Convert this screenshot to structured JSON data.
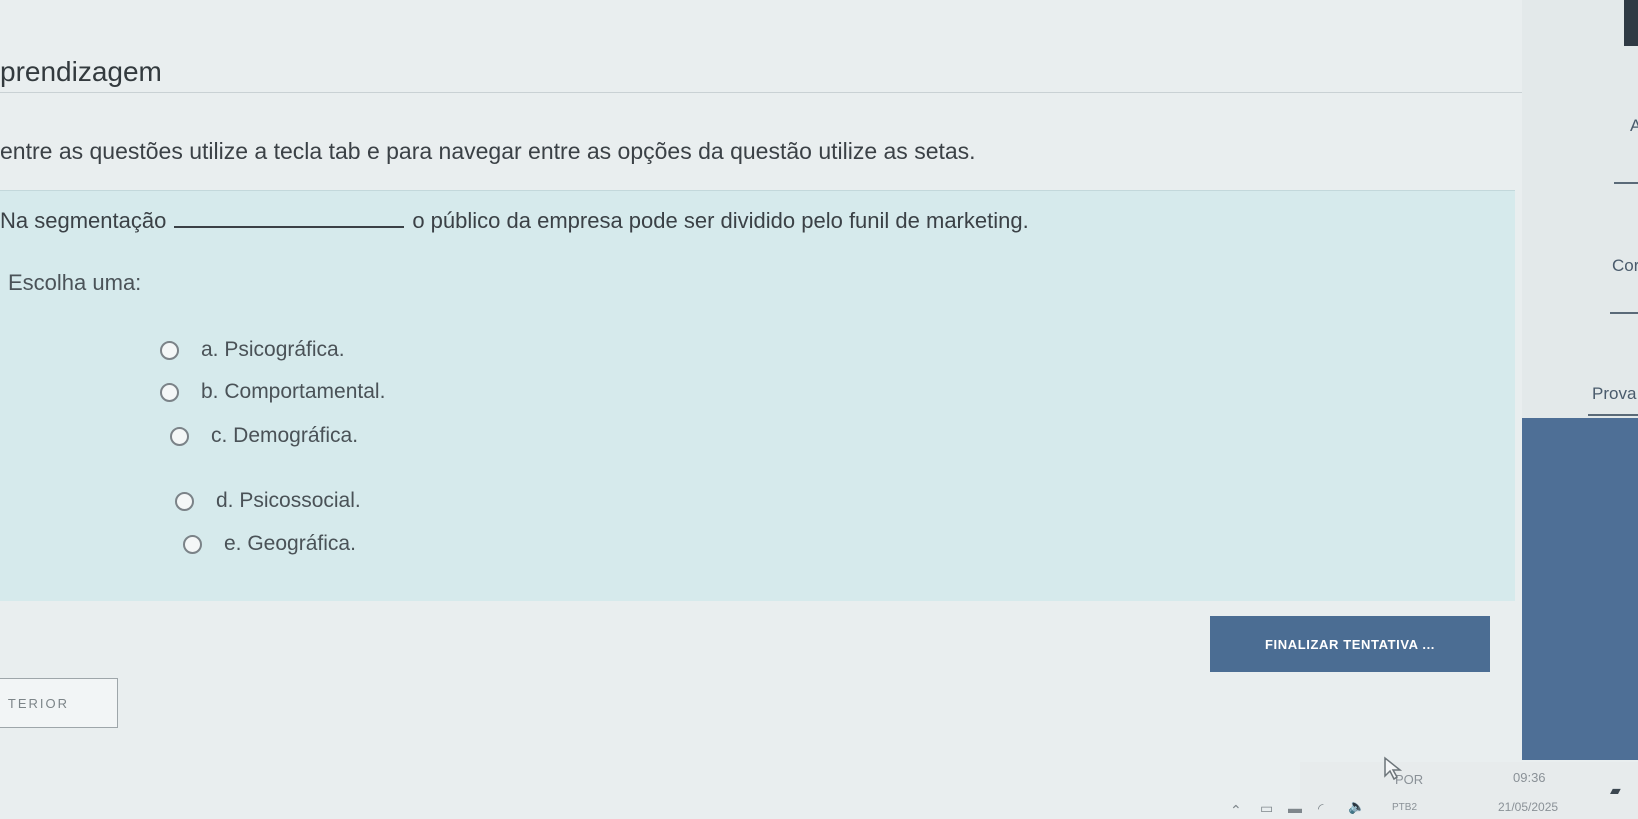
{
  "page": {
    "title": "prendizagem",
    "instructions": "entre as questões utilize a tecla tab e para navegar entre as opções da questão utilize as setas."
  },
  "question": {
    "text_before": "Na segmentação",
    "text_after": "o público da empresa pode ser dividido pelo funil de marketing.",
    "choose_label": "Escolha uma:",
    "options": [
      {
        "label": "a. Psicográfica."
      },
      {
        "label": "b. Comportamental."
      },
      {
        "label": "c. Demográfica."
      },
      {
        "label": "d. Psicossocial."
      },
      {
        "label": "e. Geográfica."
      }
    ]
  },
  "actions": {
    "finish_label": "FINALIZAR TENTATIVA ...",
    "prev_label": "TERIOR"
  },
  "side_panel": {
    "letter": "A",
    "label1": "Cor",
    "label2": "Prova",
    "accent_color": "#4e6f96"
  },
  "taskbar": {
    "lang": "POR",
    "layout": "PTB2",
    "time": "09:36",
    "date": "21/05/2025"
  }
}
